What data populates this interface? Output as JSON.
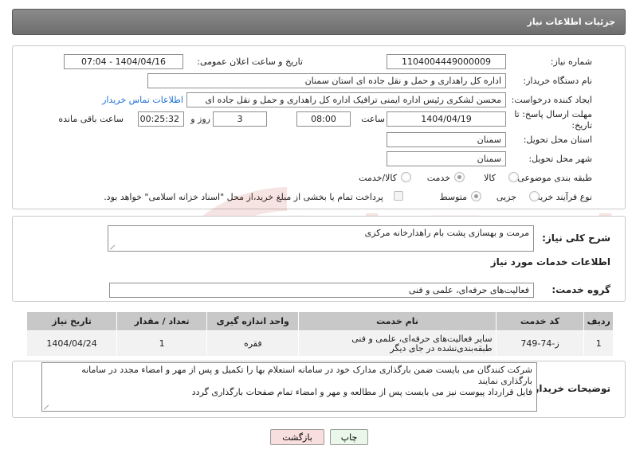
{
  "header": {
    "title": "جزئیات اطلاعات نیاز"
  },
  "fields": {
    "need_number_label": "شماره نیاز:",
    "need_number": "1104004449000009",
    "announce_label": "تاریخ و ساعت اعلان عمومی:",
    "announce_value": "1404/04/16 - 07:04",
    "buyer_org_label": "نام دستگاه خریدار:",
    "buyer_org": "اداره کل راهداری و حمل و نقل جاده ای استان سمنان",
    "requester_label": "ایجاد کننده درخواست:",
    "requester": "محسن لشکری رئیس اداره ایمنی ترافیک اداره کل راهداری و حمل و نقل جاده ای",
    "contact_link": "اطلاعات تماس خریدار",
    "deadline_label_1": "مهلت ارسال پاسخ: تا",
    "deadline_label_2": "تاریخ:",
    "deadline_date": "1404/04/19",
    "time_label": "ساعت",
    "deadline_time": "08:00",
    "days_value": "3",
    "days_label": "روز و",
    "remaining_time": "00:25:32",
    "remaining_label": "ساعت باقی مانده",
    "province_label": "استان محل تحویل:",
    "province": "سمنان",
    "city_label": "شهر محل تحویل:",
    "city": "سمنان",
    "category_label": "طبقه بندی موضوعی:",
    "category_options": [
      "کالا",
      "خدمت",
      "کالا/خدمت"
    ],
    "process_label": "نوع فرآیند خرید :",
    "process_options": [
      "جزیی",
      "متوسط"
    ],
    "payment_note": "پرداخت تمام یا بخشی از مبلغ خرید،از محل \"اسناد خزانه اسلامی\" خواهد بود."
  },
  "description": {
    "label": "شرح کلی نیاز:",
    "value": "مرمت و بهسازی پشت بام راهدارخانه مرکزی"
  },
  "services": {
    "title": "اطلاعات خدمات مورد نیاز",
    "group_label": "گروه خدمت:",
    "group_value": "فعالیت‌های حرفه‌ای، علمی و فنی",
    "table": {
      "headers": [
        "ردیف",
        "کد خدمت",
        "نام خدمت",
        "واحد اندازه گیری",
        "تعداد / مقدار",
        "تاریخ نیاز"
      ],
      "rows": [
        [
          "1",
          "ز-74-749",
          "سایر فعالیت‌های حرفه‌ای، علمی و فنی طبقه‌بندی‌نشده در جای دیگر",
          "فقره",
          "1",
          "1404/04/24"
        ]
      ]
    }
  },
  "buyer_notes": {
    "label": "توضیحات خریدار:",
    "line1": "شرکت کنندگان می بایست ضمن بارگذاری مدارک خود در سامانه استعلام بها را تکمیل و پس از مهر و امضاء مجدد در سامانه",
    "line2": "بارگذاری نمایند",
    "line3": "فایل قرارداد پیوست نیز می بایست پس از مطالعه و مهر و امضاء تمام صفحات بارگذاری گردد"
  },
  "buttons": {
    "print": "چاپ",
    "back": "بازگشت"
  },
  "watermark_text": "AriaTender.neT",
  "colors": {
    "header_bg": "#777777",
    "link": "#1a6fd6",
    "back_button_bg": "#f9dede",
    "print_button_bg": "#e9f8e9"
  }
}
